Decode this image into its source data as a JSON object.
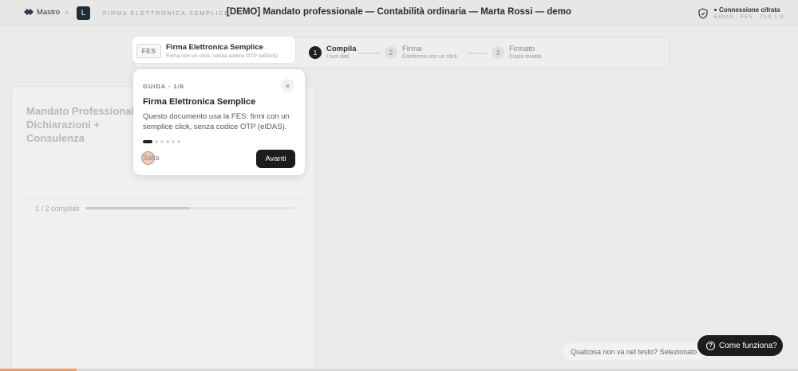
{
  "header": {
    "logo_label": "Mastro",
    "separator": "×",
    "brand_mark": "L",
    "brand_name": "FIRMA ELETTRONICA SEMPLICE",
    "document_title": "[DEMO] Mandato professionale — Contabilità ordinaria — Marta Rossi — demo",
    "connection_title": "Connessione cifrata",
    "connection_sub": "EIDAS · FES · TLS 1.3"
  },
  "mode_card": {
    "badge": "FES",
    "title": "Firma Elettronica Semplice",
    "subtitle": "Firma con un click, senza codice OTP (eIDAS)"
  },
  "stepper": {
    "steps": [
      {
        "num": "1",
        "label": "Compila",
        "sub": "I tuoi dati"
      },
      {
        "num": "2",
        "label": "Firma",
        "sub": "Conferma con un click"
      },
      {
        "num": "3",
        "label": "Firmato",
        "sub": "Copia inviata"
      }
    ]
  },
  "document": {
    "title": "Mandato Professionale Dichiarazioni + Consulenza",
    "progress_label": "1 / 2 compilati",
    "progress_fraction": 0.5
  },
  "tour": {
    "step_label": "GUIDA · 1/6",
    "close": "×",
    "title": "Firma Elettronica Semplice",
    "body": "Questo documento usa la FES: firmi con un semplice click, senza codice OTP (eIDAS).",
    "skip_label": "Salta",
    "next_label": "Avanti",
    "total_steps": 6,
    "current_step": 1
  },
  "footer": {
    "hint": "Qualcosa non va nel testo? Selezionalo",
    "help_label": "Come funziona?",
    "help_icon": "?"
  },
  "colors": {
    "accent_dark": "#1c1c1c",
    "progress_accent": "#e8a070"
  }
}
